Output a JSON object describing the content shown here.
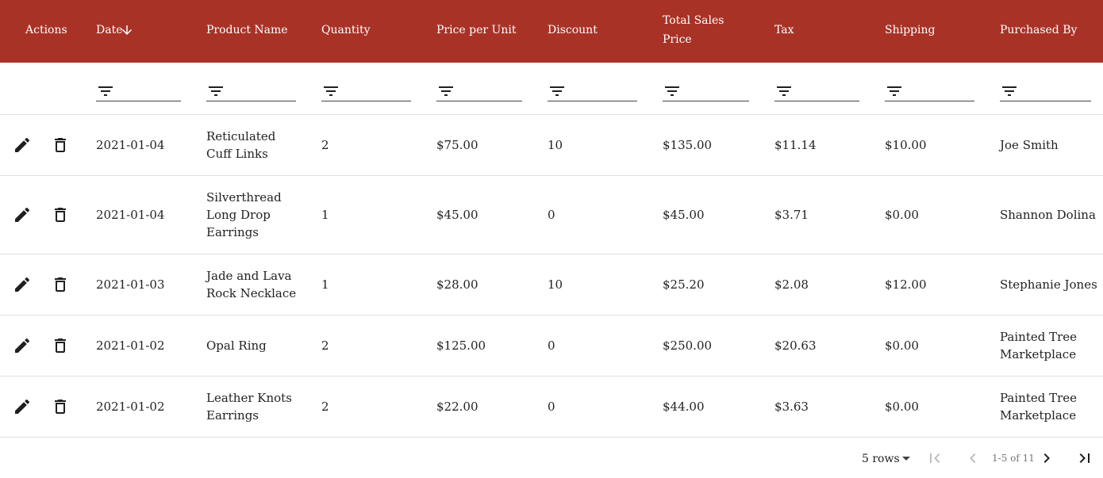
{
  "colors": {
    "header_bg": "#a93226",
    "header_text": "#ffffff",
    "icon": "#1f1f1f",
    "icon_disabled": "#bdbdbd"
  },
  "columns": {
    "actions": "Actions",
    "date": "Date",
    "product_name": "Product Name",
    "quantity": "Quantity",
    "price_per_unit": "Price per Unit",
    "discount": "Discount",
    "total_sales_price_line1": "Total Sales",
    "total_sales_price_line2": "Price",
    "tax": "Tax",
    "shipping": "Shipping",
    "purchased_by": "Purchased By"
  },
  "sort": {
    "column": "Date",
    "direction": "descending",
    "icon": "arrow-down-icon"
  },
  "rows": [
    {
      "date": "2021-01-04",
      "product_name": "Reticulated Cuff Links",
      "quantity": "2",
      "price_per_unit": "$75.00",
      "discount": "10",
      "total_sales_price": "$135.00",
      "tax": "$11.14",
      "shipping": "$10.00",
      "purchased_by": "Joe Smith"
    },
    {
      "date": "2021-01-04",
      "product_name": "Silverthread Long Drop Earrings",
      "quantity": "1",
      "price_per_unit": "$45.00",
      "discount": "0",
      "total_sales_price": "$45.00",
      "tax": "$3.71",
      "shipping": "$0.00",
      "purchased_by": "Shannon Dolina"
    },
    {
      "date": "2021-01-03",
      "product_name": "Jade and Lava Rock Necklace",
      "quantity": "1",
      "price_per_unit": "$28.00",
      "discount": "10",
      "total_sales_price": "$25.20",
      "tax": "$2.08",
      "shipping": "$12.00",
      "purchased_by": "Stephanie Jones"
    },
    {
      "date": "2021-01-02",
      "product_name": "Opal Ring",
      "quantity": "2",
      "price_per_unit": "$125.00",
      "discount": "0",
      "total_sales_price": "$250.00",
      "tax": "$20.63",
      "shipping": "$0.00",
      "purchased_by": "Painted Tree Marketplace"
    },
    {
      "date": "2021-01-02",
      "product_name": "Leather Knots Earrings",
      "quantity": "2",
      "price_per_unit": "$22.00",
      "discount": "0",
      "total_sales_price": "$44.00",
      "tax": "$3.63",
      "shipping": "$0.00",
      "purchased_by": "Painted Tree Marketplace"
    }
  ],
  "row_actions": {
    "edit_icon": "pencil-icon",
    "delete_icon": "trash-icon"
  },
  "filter_icon": "filter-icon",
  "pagination": {
    "rows_per_page": "5 rows",
    "range": "1-5 of 11",
    "first_icon": "first-page-icon",
    "prev_icon": "chevron-left-icon",
    "next_icon": "chevron-right-icon",
    "last_icon": "last-page-icon"
  }
}
